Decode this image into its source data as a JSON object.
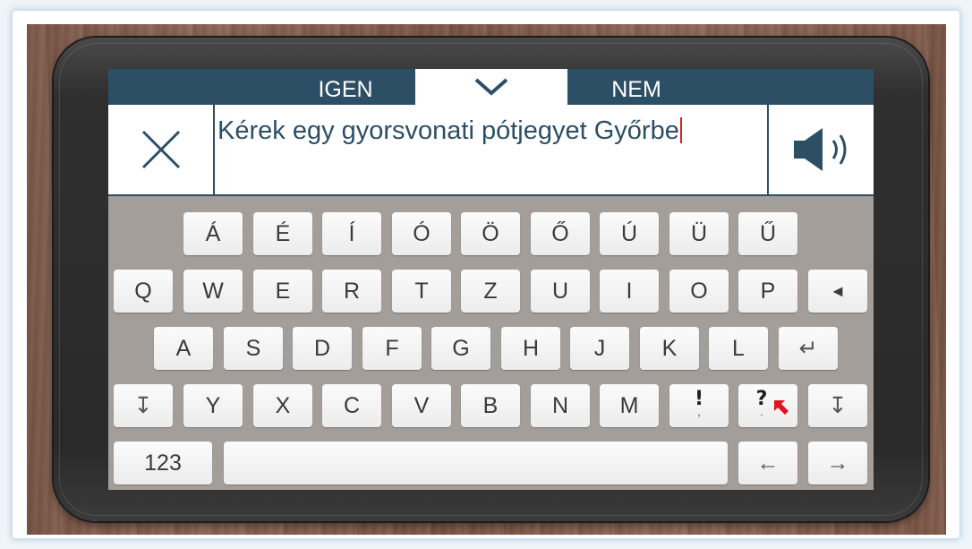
{
  "topbar": {
    "yes_label": "IGEN",
    "no_label": "NEM",
    "collapse_icon": "chevron-down-icon"
  },
  "input": {
    "text": "Kérek egy gyorsvonati pótjegyet Győrbe",
    "clear_icon": "close-icon",
    "speak_icon": "speaker-icon"
  },
  "keyboard": {
    "accent_row": [
      "Á",
      "É",
      "Í",
      "Ó",
      "Ö",
      "Ő",
      "Ú",
      "Ü",
      "Ű"
    ],
    "row1": [
      "Q",
      "W",
      "E",
      "R",
      "T",
      "Z",
      "U",
      "I",
      "O",
      "P"
    ],
    "backspace": "◄",
    "row2": [
      "A",
      "S",
      "D",
      "F",
      "G",
      "H",
      "J",
      "K",
      "L"
    ],
    "enter": "↵",
    "shift": "↧",
    "row3": [
      "Y",
      "X",
      "C",
      "V",
      "B",
      "N",
      "M"
    ],
    "exclamation": {
      "primary": "!",
      "secondary": ","
    },
    "question": {
      "primary": "?",
      "secondary": "."
    },
    "numbers": "123",
    "space": "",
    "left_arrow": "←",
    "right_arrow": "→"
  },
  "colors": {
    "bar": "#2c4f66",
    "keyboard_bg": "#a39e9a",
    "key_bg": "#f4f4f4",
    "caret": "#d0202a",
    "question_marker": "#e0141e"
  }
}
